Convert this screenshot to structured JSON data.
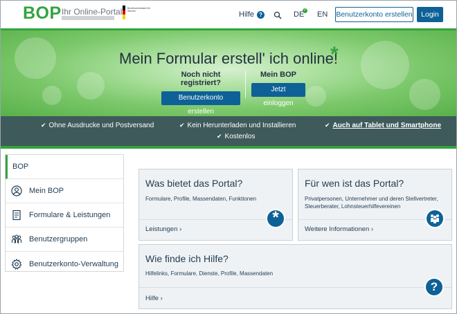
{
  "header": {
    "logo": "BOP",
    "logo_sub": "Ihr Online-Portal",
    "ministry_text": "Bundeszentralamt für Steuern",
    "help_label": "Hilfe",
    "lang_de": "DE",
    "lang_en": "EN",
    "register_button": "Benutzerkonto erstellen",
    "login_button": "Login"
  },
  "hero": {
    "title": "Mein Formular erstell' ich online!",
    "left_label": "Noch nicht registriert?",
    "left_button": "Benutzerkonto erstellen",
    "right_label": "Mein BOP",
    "right_button": "Jetzt einloggen"
  },
  "features": [
    "Ohne Ausdrucke und Postversand",
    "Kein Herunterladen und Installieren",
    "Auch auf Tablet und Smartphone",
    "Kostenlos"
  ],
  "sidebar": {
    "items": [
      {
        "label": "BOP",
        "icon": ""
      },
      {
        "label": "Mein BOP",
        "icon": "user-icon"
      },
      {
        "label": "Formulare & Leistungen",
        "icon": "document-icon"
      },
      {
        "label": "Benutzergruppen",
        "icon": "group-icon"
      },
      {
        "label": "Benutzerkonto-Verwaltung",
        "icon": "gear-icon"
      }
    ]
  },
  "cards": [
    {
      "title": "Was bietet das Portal?",
      "text": "Formulare, Profile, Massendaten, Funktionen",
      "link": "Leistungen",
      "icon": "asterisk-icon"
    },
    {
      "title": "Für wen ist das Portal?",
      "text": "Privatpersonen, Unternehmer und deren Stellvertreter, Steuerberater, Lohnsteuerhilfevereinen",
      "link": "Weitere Informationen",
      "icon": "people-icon"
    },
    {
      "title": "Wie finde ich Hilfe?",
      "text": "Hilfelinks, Formulare, Dienste, Profile, Massendaten",
      "link": "Hilfe",
      "icon": "question-icon"
    }
  ],
  "colors": {
    "brand_green": "#33a33e",
    "primary_blue": "#0e6196",
    "strip_dark": "#3f5a5a"
  }
}
